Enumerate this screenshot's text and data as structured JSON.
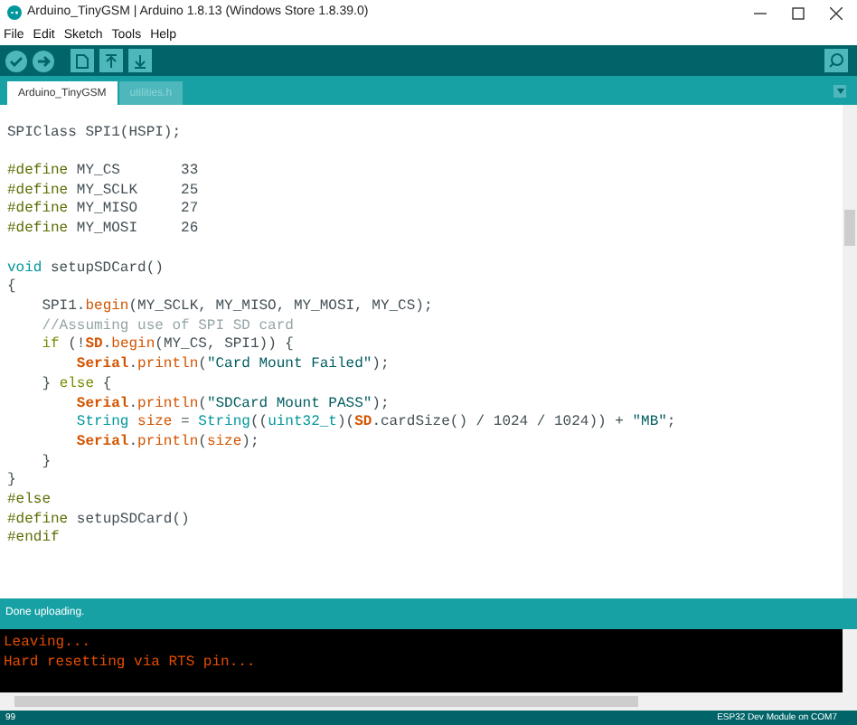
{
  "window": {
    "title": "Arduino_TinyGSM | Arduino 1.8.13 (Windows Store 1.8.39.0)"
  },
  "menu": [
    "File",
    "Edit",
    "Sketch",
    "Tools",
    "Help"
  ],
  "tabs": [
    {
      "label": "Arduino_TinyGSM",
      "selected": true
    },
    {
      "label": "utilities.h",
      "selected": false
    }
  ],
  "editor": {
    "lines": [
      {
        "blank_before": true,
        "tokens": [
          {
            "kind": "plain",
            "text": "SPIClass SPI1(HSPI);"
          }
        ]
      },
      {
        "blank_before": true,
        "tokens": [
          {
            "kind": "preproc",
            "text": "#define"
          },
          {
            "kind": "plain",
            "text": " MY_CS       33"
          }
        ]
      },
      {
        "blank_before": false,
        "tokens": [
          {
            "kind": "preproc",
            "text": "#define"
          },
          {
            "kind": "plain",
            "text": " MY_SCLK     25"
          }
        ]
      },
      {
        "blank_before": false,
        "tokens": [
          {
            "kind": "preproc",
            "text": "#define"
          },
          {
            "kind": "plain",
            "text": " MY_MISO     27"
          }
        ]
      },
      {
        "blank_before": false,
        "tokens": [
          {
            "kind": "preproc",
            "text": "#define"
          },
          {
            "kind": "plain",
            "text": " MY_MOSI     26"
          }
        ]
      },
      {
        "blank_before": true,
        "tokens": [
          {
            "kind": "type",
            "text": "void"
          },
          {
            "kind": "plain",
            "text": " setupSDCard()"
          }
        ]
      },
      {
        "blank_before": false,
        "tokens": [
          {
            "kind": "plain",
            "text": "{"
          }
        ]
      },
      {
        "blank_before": false,
        "tokens": [
          {
            "kind": "plain",
            "text": "    SPI1."
          },
          {
            "kind": "function",
            "text": "begin"
          },
          {
            "kind": "plain",
            "text": "(MY_SCLK, MY_MISO, MY_MOSI, MY_CS);"
          }
        ]
      },
      {
        "blank_before": false,
        "tokens": [
          {
            "kind": "comment",
            "text": "    //Assuming use of SPI SD card"
          }
        ]
      },
      {
        "blank_before": false,
        "tokens": [
          {
            "kind": "keyword",
            "text": "    if"
          },
          {
            "kind": "plain",
            "text": " (!"
          },
          {
            "kind": "class",
            "text": "SD"
          },
          {
            "kind": "plain",
            "text": "."
          },
          {
            "kind": "function",
            "text": "begin"
          },
          {
            "kind": "plain",
            "text": "(MY_CS, SPI1)) {"
          }
        ]
      },
      {
        "blank_before": false,
        "tokens": [
          {
            "kind": "class",
            "text": "        Serial"
          },
          {
            "kind": "plain",
            "text": "."
          },
          {
            "kind": "function",
            "text": "println"
          },
          {
            "kind": "plain",
            "text": "("
          },
          {
            "kind": "string",
            "text": "\"Card Mount Failed\""
          },
          {
            "kind": "plain",
            "text": ");"
          }
        ]
      },
      {
        "blank_before": false,
        "tokens": [
          {
            "kind": "plain",
            "text": "    } "
          },
          {
            "kind": "keyword",
            "text": "else"
          },
          {
            "kind": "plain",
            "text": " {"
          }
        ]
      },
      {
        "blank_before": false,
        "tokens": [
          {
            "kind": "class",
            "text": "        Serial"
          },
          {
            "kind": "plain",
            "text": "."
          },
          {
            "kind": "function",
            "text": "println"
          },
          {
            "kind": "plain",
            "text": "("
          },
          {
            "kind": "string",
            "text": "\"SDCard Mount PASS\""
          },
          {
            "kind": "plain",
            "text": ");"
          }
        ]
      },
      {
        "blank_before": false,
        "tokens": [
          {
            "kind": "type",
            "text": "        String"
          },
          {
            "kind": "function",
            "text": " size"
          },
          {
            "kind": "plain",
            "text": " = "
          },
          {
            "kind": "type",
            "text": "String"
          },
          {
            "kind": "plain",
            "text": "(("
          },
          {
            "kind": "type",
            "text": "uint32_t"
          },
          {
            "kind": "plain",
            "text": ")("
          },
          {
            "kind": "class",
            "text": "SD"
          },
          {
            "kind": "plain",
            "text": ".cardSize() / 1024 / 1024)) + "
          },
          {
            "kind": "string",
            "text": "\"MB\""
          },
          {
            "kind": "plain",
            "text": ";"
          }
        ]
      },
      {
        "blank_before": false,
        "tokens": [
          {
            "kind": "class",
            "text": "        Serial"
          },
          {
            "kind": "plain",
            "text": "."
          },
          {
            "kind": "function",
            "text": "println"
          },
          {
            "kind": "plain",
            "text": "("
          },
          {
            "kind": "function",
            "text": "size"
          },
          {
            "kind": "plain",
            "text": ");"
          }
        ]
      },
      {
        "blank_before": false,
        "tokens": [
          {
            "kind": "plain",
            "text": "    }"
          }
        ]
      },
      {
        "blank_before": false,
        "tokens": [
          {
            "kind": "plain",
            "text": "}"
          }
        ]
      },
      {
        "blank_before": false,
        "tokens": [
          {
            "kind": "preproc",
            "text": "#else"
          }
        ]
      },
      {
        "blank_before": false,
        "tokens": [
          {
            "kind": "preproc",
            "text": "#define"
          },
          {
            "kind": "plain",
            "text": " setupSDCard()"
          }
        ]
      },
      {
        "blank_before": false,
        "tokens": [
          {
            "kind": "preproc",
            "text": "#endif"
          }
        ]
      }
    ]
  },
  "status": "Done uploading.",
  "console": [
    "Leaving...",
    "Hard resetting via RTS pin..."
  ],
  "footer": {
    "line": "99",
    "board": "ESP32 Dev Module on COM7"
  }
}
